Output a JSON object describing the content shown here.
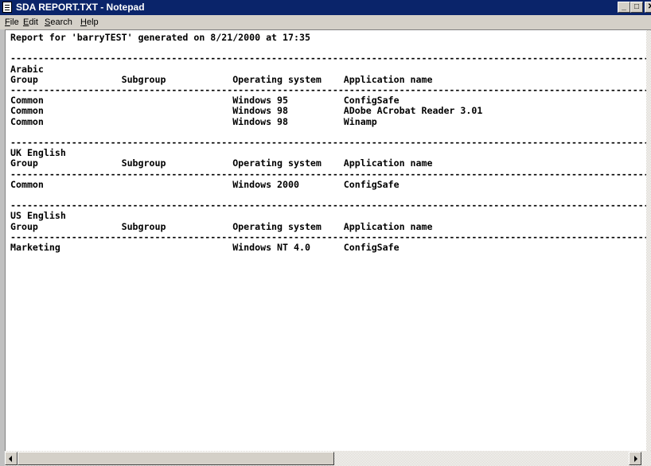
{
  "window": {
    "title": "SDA REPORT.TXT - Notepad",
    "minimize_glyph": "_",
    "maximize_glyph": "□",
    "close_glyph": "✕"
  },
  "menu": [
    {
      "label": "File",
      "accel": "F",
      "rest": "ile"
    },
    {
      "label": "Edit",
      "accel": "E",
      "rest": "dit"
    },
    {
      "label": "Search",
      "accel": "S",
      "rest": "earch"
    },
    {
      "label": "Help",
      "accel": "H",
      "rest": "elp"
    }
  ],
  "report": {
    "header": "Report for 'barryTEST' generated on 8/21/2000 at 17:35",
    "columns": [
      "Group",
      "Subgroup",
      "Operating system",
      "Application name"
    ],
    "sections": [
      {
        "language": "Arabic",
        "rows": [
          {
            "group": "Common",
            "subgroup": "",
            "os": "Windows 95",
            "app": "ConfigSafe"
          },
          {
            "group": "Common",
            "subgroup": "",
            "os": "Windows 98",
            "app": "ADobe ACrobat Reader 3.01"
          },
          {
            "group": "Common",
            "subgroup": "",
            "os": "Windows 98",
            "app": "Winamp"
          }
        ]
      },
      {
        "language": "UK English",
        "rows": [
          {
            "group": "Common",
            "subgroup": "",
            "os": "Windows 2000",
            "app": "ConfigSafe"
          }
        ]
      },
      {
        "language": "US English",
        "rows": [
          {
            "group": "Marketing",
            "subgroup": "",
            "os": "Windows NT 4.0",
            "app": "ConfigSafe"
          }
        ]
      }
    ]
  }
}
